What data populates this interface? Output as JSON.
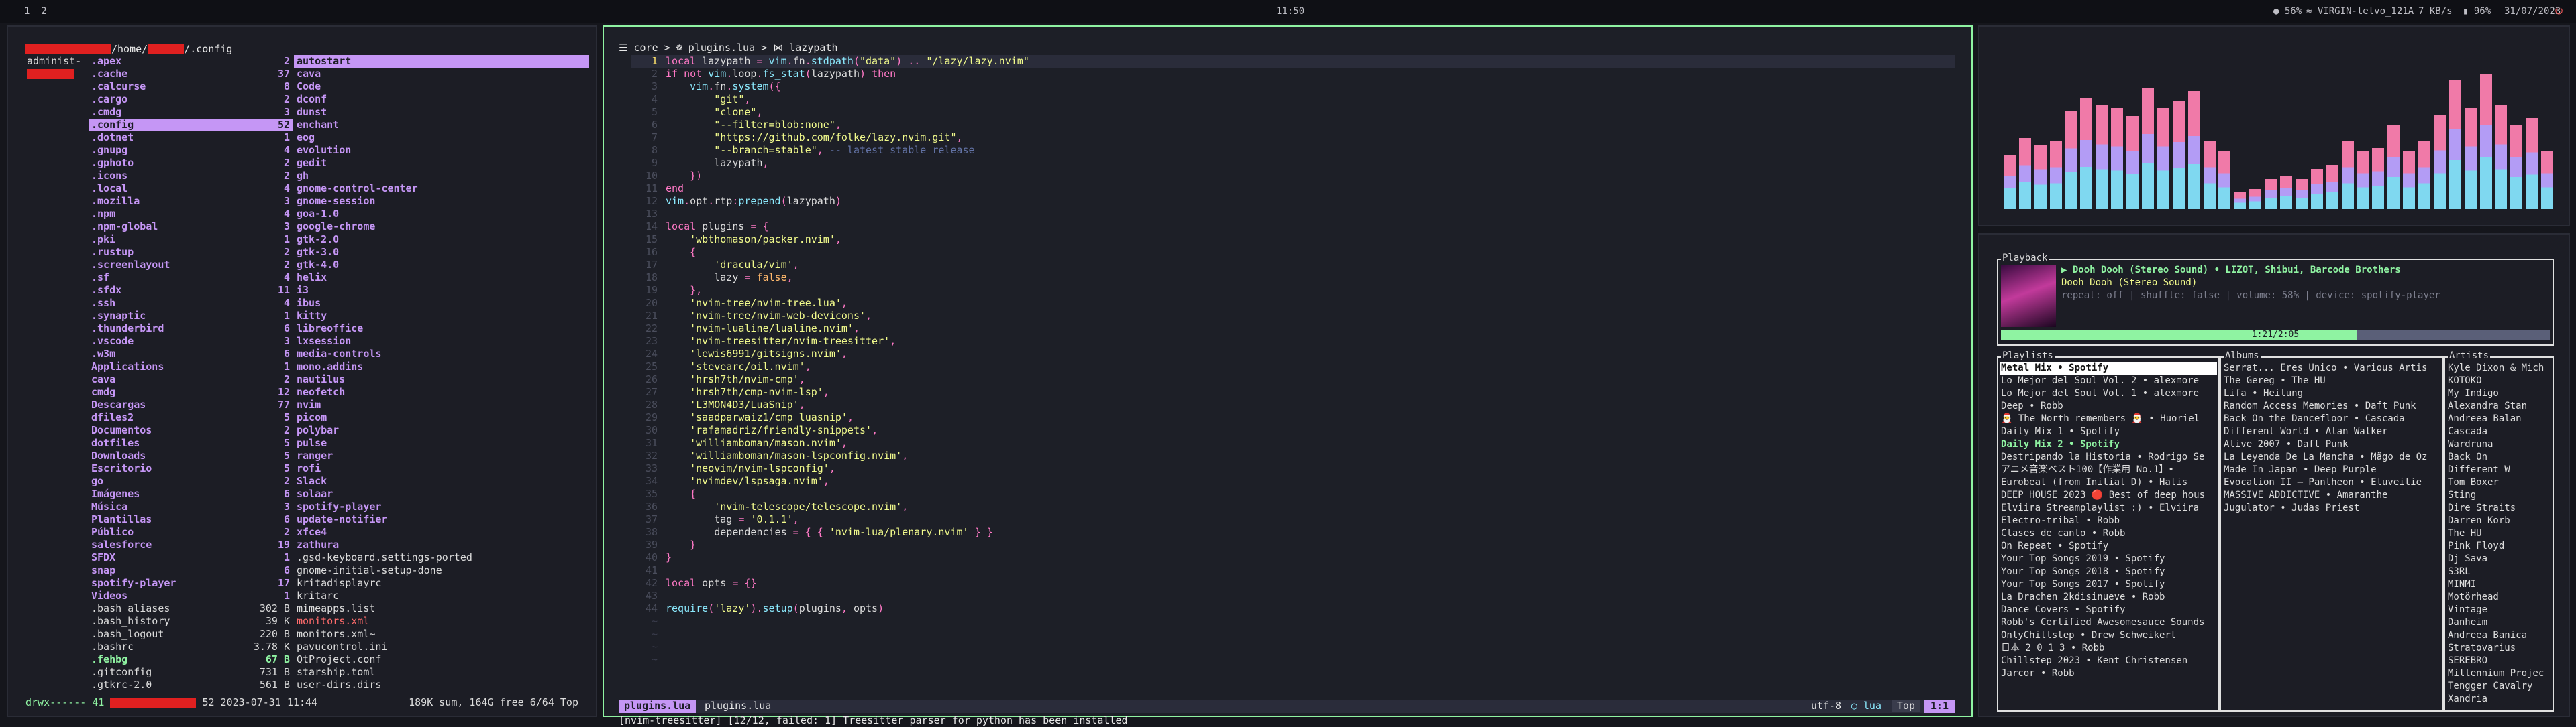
{
  "topbar": {
    "workspaces": "1  2",
    "clock": "11:50",
    "status": {
      "cpu": "56%",
      "network": "VIRGIN-telvo_121A",
      "speed": "7 KB/s",
      "battery": "96%",
      "date": "31/07/2023"
    }
  },
  "fm": {
    "path_prefix": "/home/",
    "path_suffix": "/.config",
    "user_label": "administ",
    "parent": [
      ".apex",
      ".cache",
      ".calcurse",
      ".cargo",
      ".cmdg",
      ".config",
      ".dotnet",
      ".gnupg",
      ".gphoto",
      ".icons",
      ".local",
      ".mozilla",
      ".npm",
      ".npm-global",
      ".pki",
      ".rustup",
      ".screenlayout",
      ".sf",
      ".sfdx",
      ".ssh",
      ".synaptic",
      ".thunderbird",
      ".vscode",
      ".w3m",
      "Applications",
      "cava",
      "cmdg",
      "Descargas",
      "dfiles2",
      "Documentos",
      "dotfiles",
      "Downloads",
      "Escritorio",
      "go",
      "Imágenes",
      "Música",
      "Plantillas",
      "Público",
      "salesforce",
      "SFDX",
      "snap",
      "spotify-player",
      "Videos",
      ".bash_aliases",
      ".bash_history",
      ".bash_logout",
      ".bashrc",
      ".fehbg",
      ".gitconfig",
      ".gtkrc-2.0"
    ],
    "parent_counts": [
      "2",
      "37",
      "8",
      "2",
      "3",
      "52",
      "1",
      "4",
      "2",
      "2",
      "4",
      "3",
      "4",
      "3",
      "1",
      "2",
      "2",
      "4",
      "11",
      "4",
      "1",
      "6",
      "3",
      "6",
      "1",
      "2",
      "12",
      "77",
      "5",
      "2",
      "5",
      "5",
      "5",
      "2",
      "6",
      "3",
      "6",
      "2",
      "19",
      "1",
      "6",
      "17",
      "1",
      "302 B",
      "39 K",
      "220 B",
      "3.78 K",
      "67 B",
      "731 B",
      "561 B"
    ],
    "children": [
      "autostart",
      "cava",
      "Code",
      "dconf",
      "dunst",
      "enchant",
      "eog",
      "evolution",
      "gedit",
      "gh",
      "gnome-control-center",
      "gnome-session",
      "goa-1.0",
      "google-chrome",
      "gtk-2.0",
      "gtk-3.0",
      "gtk-4.0",
      "helix",
      "i3",
      "ibus",
      "kitty",
      "libreoffice",
      "lxsession",
      "media-controls",
      "mono.addins",
      "nautilus",
      "neofetch",
      "nvim",
      "picom",
      "polybar",
      "pulse",
      "ranger",
      "rofi",
      "Slack",
      "solaar",
      "spotify-player",
      "update-notifier",
      "xfce4",
      "zathura",
      ".gsd-keyboard.settings-ported",
      "gnome-initial-setup-done",
      "kritadisplayrc",
      "kritarc",
      "mimeapps.list",
      "monitors.xml",
      "monitors.xml~",
      "pavucontrol.ini",
      "QtProject.conf",
      "starship.toml",
      "user-dirs.dirs"
    ],
    "status_left": "drwx------ 41",
    "status_mid": "52 2023-07-31 11:44",
    "status_right": "189K sum, 164G free  6/64  Top"
  },
  "editor": {
    "breadcrumb": "core > ☸ plugins.lua > ⋈ lazypath",
    "lines": [
      "local lazypath = vim.fn.stdpath(\"data\") .. \"/lazy/lazy.nvim\"",
      "if not vim.loop.fs_stat(lazypath) then",
      "    vim.fn.system({",
      "        \"git\",",
      "        \"clone\",",
      "        \"--filter=blob:none\",",
      "        \"https://github.com/folke/lazy.nvim.git\",",
      "        \"--branch=stable\", -- latest stable release",
      "        lazypath,",
      "    })",
      "end",
      "vim.opt.rtp:prepend(lazypath)",
      "",
      "local plugins = {",
      "    'wbthomason/packer.nvim',",
      "    {",
      "        'dracula/vim',",
      "        lazy = false,",
      "    },",
      "    'nvim-tree/nvim-tree.lua',",
      "    'nvim-tree/nvim-web-devicons',",
      "    'nvim-lualine/lualine.nvim',",
      "    'nvim-treesitter/nvim-treesitter',",
      "    'lewis6991/gitsigns.nvim',",
      "    'stevearc/oil.nvim',",
      "    'hrsh7th/nvim-cmp',",
      "    'hrsh7th/cmp-nvim-lsp',",
      "    'L3MON4D3/LuaSnip',",
      "    'saadparwaiz1/cmp_luasnip',",
      "    'rafamadriz/friendly-snippets',",
      "    'williamboman/mason.nvim',",
      "    'williamboman/mason-lspconfig.nvim',",
      "    'neovim/nvim-lspconfig',",
      "    'nvimdev/lspsaga.nvim',",
      "    {",
      "        'nvim-telescope/telescope.nvim',",
      "        tag = '0.1.1',",
      "        dependencies = { { 'nvim-lua/plenary.nvim' } }",
      "    }",
      "}",
      "",
      "local opts = {}",
      "",
      "require('lazy').setup(plugins, opts)"
    ],
    "statusline": {
      "mode_file": "plugins.lua",
      "file": "plugins.lua",
      "encoding": "utf-8",
      "filetype": "lua",
      "position_word": "Top",
      "position": "1:1"
    },
    "message": "[nvim-treesitter] [12/12, failed: 1] Treesitter parser for python has been installed"
  },
  "visualizer": {
    "levels": [
      0.32,
      0.42,
      0.38,
      0.4,
      0.58,
      0.66,
      0.62,
      0.6,
      0.55,
      0.72,
      0.6,
      0.64,
      0.7,
      0.4,
      0.34,
      0.1,
      0.12,
      0.18,
      0.2,
      0.18,
      0.24,
      0.26,
      0.4,
      0.34,
      0.36,
      0.5,
      0.34,
      0.4,
      0.56,
      0.76,
      0.6,
      0.8,
      0.62,
      0.5,
      0.54,
      0.34
    ]
  },
  "player": {
    "playback_title": "Playback",
    "track_line": "▶ Dooh Dooh (Stereo Sound) • LIZOT, Shibui, Barcode Brothers",
    "album_line": "Dooh Dooh (Stereo Sound)",
    "info_line": "repeat: off | shuffle: false | volume: 58% | device: spotify-player",
    "progress_label": "1:21/2:05",
    "progress_fraction": 0.648,
    "playlists_title": "Playlists",
    "playlists": [
      "Metal Mix • Spotify",
      "Lo Mejor del Soul Vol. 2 • alexmore",
      "Lo Mejor del Soul Vol. 1 • alexmore",
      "Deep • Robb",
      "🎅 The North remembers 🎅 • Huoriel",
      "Daily Mix 1 • Spotify",
      "Destripando la Historia • Rodrigo Se",
      "アニメ音楽ベスト100【作業用 No.1】•",
      "Eurobeat (from Initial D) • Halis",
      "DEEP HOUSE 2023 🔴 Best of deep hous",
      "Elviira Streamplaylist :) • Elviira",
      "Electro-tribal • Robb",
      "Clases de canto • Robb",
      "On Repeat • Spotify",
      "Your Top Songs 2019 • Spotify",
      "Your Top Songs 2018 • Spotify",
      "Your Top Songs 2017 • Spotify",
      "La Drachen 2kdisinueve • Robb",
      "Dance Covers • Spotify",
      "Robb's Certified Awesomesauce Sounds",
      "OnlyChillstep • Drew Schweikert",
      "日本 2 0 1 3 • Robb",
      "Chillstep 2023 • Kent Christensen",
      "Jarcor • Robb"
    ],
    "playlists_highlight": "Daily Mix 2 • Spotify",
    "albums_title": "Albums",
    "albums": [
      "Serrat... Eres Unico • Various Artis",
      "The Gereg • The HU",
      "Lifa • Heilung",
      "Random Access Memories • Daft Punk",
      "Back On the Dancefloor • Cascada",
      "Different World • Alan Walker",
      "Alive 2007 • Daft Punk",
      "La Leyenda De La Mancha • Mägo de Oz",
      "Made In Japan • Deep Purple",
      "Evocation II – Pantheon • Eluveitie",
      "MASSIVE ADDICTIVE • Amaranthe",
      "Jugulator • Judas Priest"
    ],
    "artists_title": "Artists",
    "artists": [
      "Kyle Dixon & Mich",
      "KOTOKO",
      "My Indigo",
      "Alexandra Stan",
      "Andreea Balan",
      "Cascada",
      "Wardruna",
      "Back On",
      "Different W",
      "Tom Boxer",
      "Sting",
      "Dire Straits",
      "Darren Korb",
      "The HU",
      "Pink Floyd",
      "Dj Sava",
      "S3RL",
      "MINMI",
      "Motörhead",
      "Vintage",
      "Danheim",
      "Andreea Banica",
      "Stratovarius",
      "SEREBRO",
      "Millennium Projec",
      "Tengger Cavalry",
      "Xandria"
    ]
  },
  "colors": {
    "accent_purple": "#c596f5",
    "accent_green": "#8ff3a2",
    "bar_pink": "#f07aa8",
    "bar_purple": "#b39cf5",
    "bar_cyan": "#7fd8f0"
  }
}
